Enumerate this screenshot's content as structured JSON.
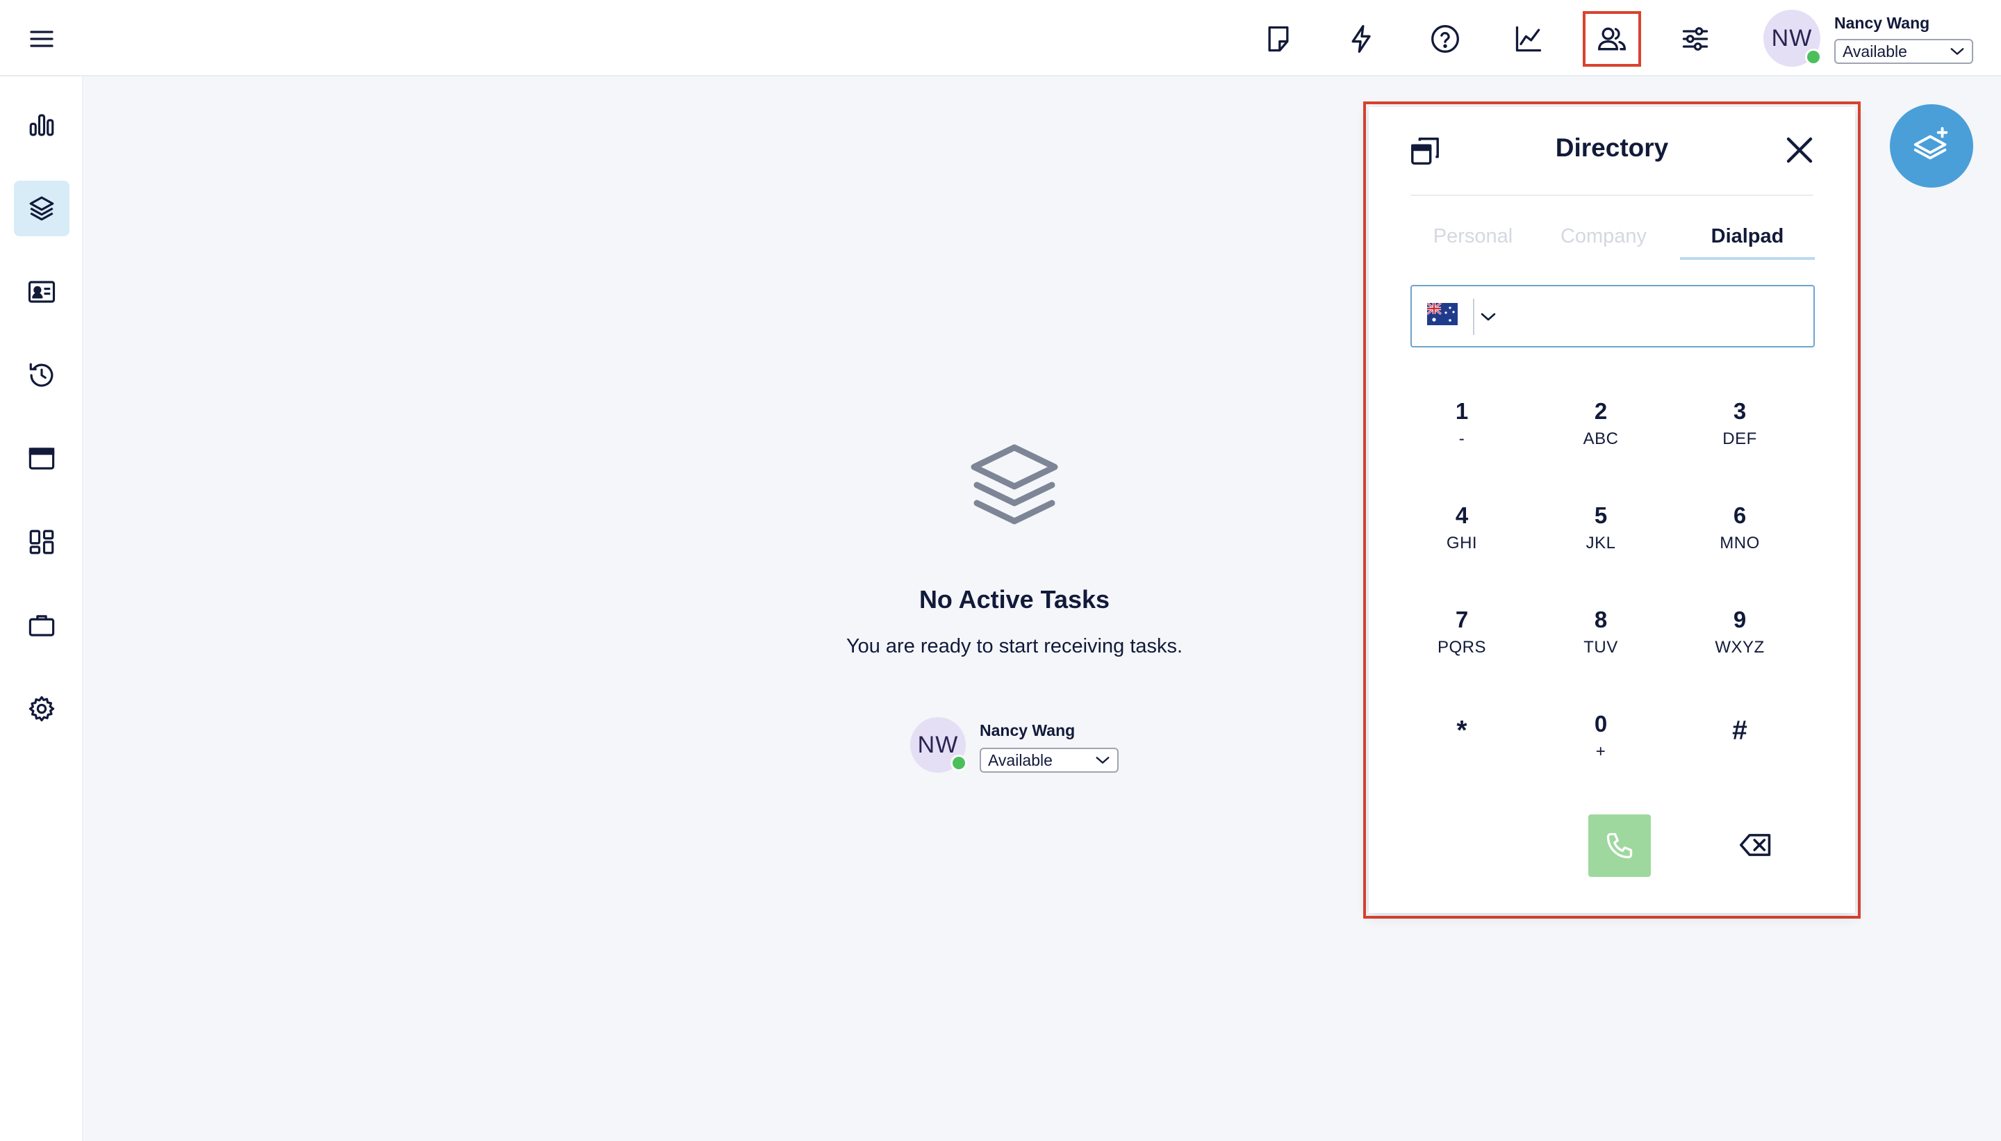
{
  "header": {
    "icons": [
      "notes-icon",
      "bolt-icon",
      "help-icon",
      "analytics-icon",
      "directory-icon",
      "settings-sliders-icon"
    ],
    "user": {
      "initials": "NW",
      "name": "Nancy Wang",
      "status": "Available"
    }
  },
  "sidebar": {
    "items": [
      {
        "name": "dashboard",
        "icon": "bar-chart-icon"
      },
      {
        "name": "tasks",
        "icon": "layers-icon",
        "active": true
      },
      {
        "name": "contacts",
        "icon": "contact-card-icon"
      },
      {
        "name": "history",
        "icon": "history-icon"
      },
      {
        "name": "window",
        "icon": "browser-window-icon"
      },
      {
        "name": "apps",
        "icon": "grid-icon"
      },
      {
        "name": "work",
        "icon": "briefcase-icon"
      },
      {
        "name": "settings",
        "icon": "gear-icon"
      }
    ]
  },
  "main": {
    "empty_title": "No Active Tasks",
    "empty_subtitle": "You are ready to start receiving tasks.",
    "user": {
      "initials": "NW",
      "name": "Nancy Wang",
      "status": "Available"
    }
  },
  "directory": {
    "title": "Directory",
    "tabs": [
      {
        "label": "Personal",
        "active": false
      },
      {
        "label": "Company",
        "active": false
      },
      {
        "label": "Dialpad",
        "active": true
      }
    ],
    "phone_input": {
      "country": "AU",
      "value": ""
    },
    "keys": [
      {
        "digit": "1",
        "letters": "-"
      },
      {
        "digit": "2",
        "letters": "ABC"
      },
      {
        "digit": "3",
        "letters": "DEF"
      },
      {
        "digit": "4",
        "letters": "GHI"
      },
      {
        "digit": "5",
        "letters": "JKL"
      },
      {
        "digit": "6",
        "letters": "MNO"
      },
      {
        "digit": "7",
        "letters": "PQRS"
      },
      {
        "digit": "8",
        "letters": "TUV"
      },
      {
        "digit": "9",
        "letters": "WXYZ"
      },
      {
        "digit": "*",
        "letters": ""
      },
      {
        "digit": "0",
        "letters": "+"
      },
      {
        "digit": "#",
        "letters": ""
      }
    ]
  },
  "colors": {
    "accent": "#4a9fd8",
    "highlight_border": "#d9432f",
    "call_button": "#9ed89e",
    "status_online": "#4cbf5c",
    "avatar_bg": "#e4dff4"
  }
}
